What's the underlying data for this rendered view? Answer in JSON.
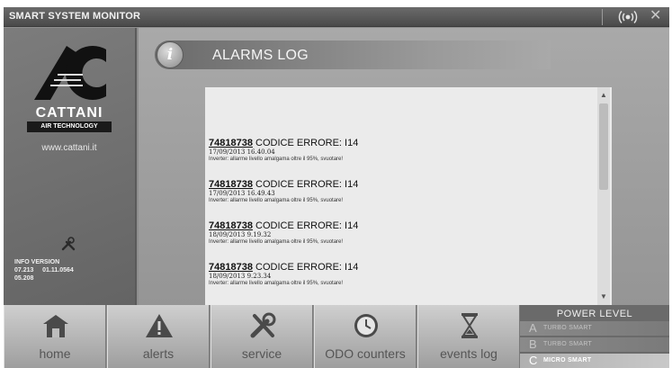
{
  "app": {
    "title": "SMART SYSTEM MONITOR"
  },
  "topbar": {
    "signal_icon": "wireless-signal-icon",
    "close_icon": "close-icon",
    "close_glyph": "✕"
  },
  "sidebar": {
    "brand_name": "CATTANI",
    "brand_sub": "AIR TECHNOLOGY",
    "website": "www.cattani.it",
    "info_version_title": "INFO VERSION",
    "info_version_line1": "07.213     01.11.0564",
    "info_version_line2": "05.208"
  },
  "main": {
    "info_glyph": "i",
    "title": "ALARMS LOG",
    "scroll_up": "▲",
    "scroll_down": "▼",
    "entries": [
      {
        "code": "74818738",
        "message": "CODICE ERRORE: I14",
        "time": "17/09/2013 16.40.04",
        "description": "Inverter: allarme livello amalgama oltre il 95%, svuotare!"
      },
      {
        "code": "74818738",
        "message": "CODICE ERRORE: I14",
        "time": "17/09/2013 16.49.43",
        "description": "Inverter: allarme livello amalgama oltre il 95%, svuotare!"
      },
      {
        "code": "74818738",
        "message": "CODICE ERRORE: I14",
        "time": "18/09/2013 9.19.32",
        "description": "Inverter: allarme livello amalgama oltre il 95%, svuotare!"
      },
      {
        "code": "74818738",
        "message": "CODICE ERRORE: I14",
        "time": "18/09/2013 9.23.34",
        "description": "Inverter: allarme livello amalgama oltre il 95%, svuotare!"
      }
    ]
  },
  "nav": {
    "home": "home",
    "alerts": "alerts",
    "service": "service",
    "odo": "ODO counters",
    "events": "events log"
  },
  "power": {
    "title": "POWER LEVEL",
    "items": [
      {
        "letter": "A",
        "label": "TURBO SMART",
        "active": false
      },
      {
        "letter": "B",
        "label": "TURBO SMART",
        "active": false
      },
      {
        "letter": "C",
        "label": "MICRO SMART",
        "active": true
      }
    ]
  }
}
